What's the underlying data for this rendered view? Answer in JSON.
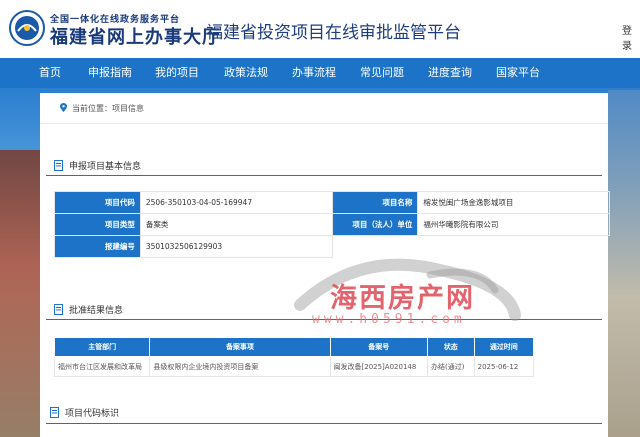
{
  "header": {
    "logo_top": "全国一体化在线政务服务平台",
    "logo_main": "福建省网上办事大厅",
    "platform_title": "福建省投资项目在线审批监管平台",
    "login": "登录"
  },
  "nav": [
    "首页",
    "申报指南",
    "我的项目",
    "政策法规",
    "办事流程",
    "常见问题",
    "进度查询",
    "国家平台"
  ],
  "breadcrumb": "当前位置：项目信息",
  "basic_section": {
    "title": "申报项目基本信息",
    "project_code_label": "项目代码",
    "project_code": "2506-350103-04-05-169947",
    "project_name_label": "项目名称",
    "project_name": "榕发悦闽广场金逸影城项目",
    "project_type_label": "项目类型",
    "project_type": "备案类",
    "legal_unit_label": "项目（法人）单位",
    "legal_unit": "福州华曦影院有限公司",
    "report_no_label": "报建编号",
    "report_no": "3501032506129903"
  },
  "approval_section": {
    "title": "批准结果信息",
    "headers": [
      "主管部门",
      "备案事项",
      "备案号",
      "状态",
      "通过时间"
    ],
    "rows": [
      [
        "福州市台江区发展和改革局",
        "县级权限内企业境内投资项目备案",
        "闽发改备[2025]A020148",
        "办结(通过)",
        "2025-06-12"
      ]
    ]
  },
  "code_section": {
    "title": "项目代码标识"
  },
  "watermark": {
    "text": "海西房产网",
    "url": "www.h0591.com"
  },
  "colors": {
    "nav": "#1c73c7",
    "title": "#1d3d80",
    "watermark": "#e04a55"
  }
}
